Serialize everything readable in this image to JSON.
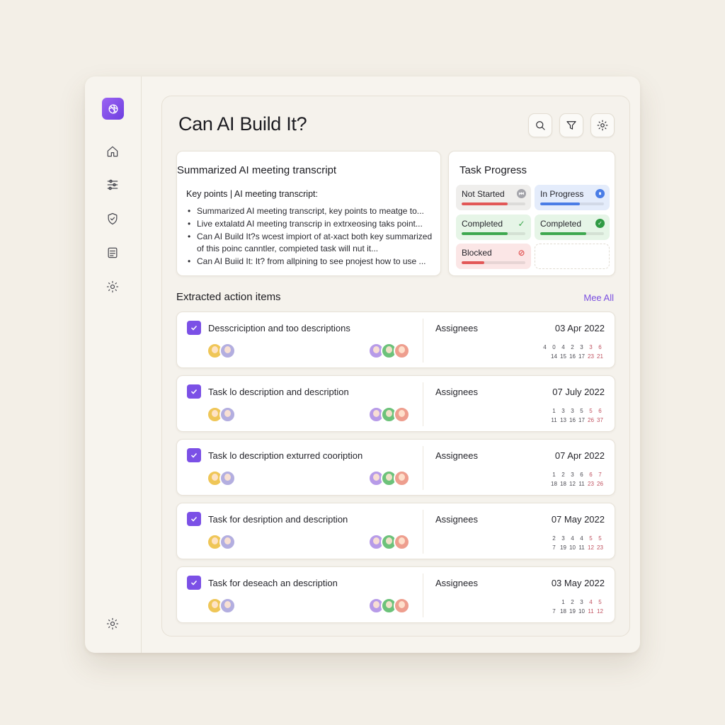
{
  "header": {
    "title": "Can AI Build It?"
  },
  "toolbar": {
    "search_icon": "search-icon",
    "filter_icon": "filter-icon",
    "settings_icon": "gear-icon"
  },
  "sidebar": {
    "logo": "openai-logo",
    "items": [
      {
        "icon": "home-icon"
      },
      {
        "icon": "sliders-icon"
      },
      {
        "icon": "shield-check-icon"
      },
      {
        "icon": "document-icon"
      },
      {
        "icon": "gear-icon"
      }
    ],
    "bottom_icon": "gear-icon"
  },
  "summary": {
    "title": "Summarized AI meeting transcript",
    "subtitle": "Key points | AI meeting transcript:",
    "bullets": [
      "Summarized AI meeting transcript, key points to meatge to...",
      "Live extalatd AI meeting transcrip in extrxeosing taks point...",
      "Can AI Build It?s wcest impiort of at-xact both key summarized of this poinc canntler, compieted task will nut it...",
      "Can AI Buiid It: It? from allpining to see pnojest how to use ..."
    ]
  },
  "progress": {
    "title": "Task Progress",
    "tiles": [
      {
        "label": "Not Started",
        "fill": 0.72,
        "bg": "#efeeec",
        "bar": "#e25757",
        "icon_bg": "#a4a4aa",
        "icon": "⏮"
      },
      {
        "label": "In Progress",
        "fill": 0.62,
        "bg": "#e4ecfb",
        "bar": "#4a7de6",
        "icon_bg": "#4a7de6",
        "icon": "⏸"
      },
      {
        "label": "Completed",
        "fill": 0.72,
        "bg": "#e6f5e7",
        "bar": "#3ea84f",
        "icon_bg": "transparent",
        "icon": "✓"
      },
      {
        "label": "Completed",
        "fill": 0.72,
        "bg": "#e6f5e7",
        "bar": "#3ea84f",
        "icon_bg": "#2f9a44",
        "icon": "✓"
      },
      {
        "label": "Blocked",
        "fill": 0.35,
        "bg": "#fbe6e6",
        "bar": "#e25757",
        "icon_bg": "transparent",
        "icon": "⊘"
      }
    ]
  },
  "actions": {
    "title": "Extracted action items",
    "see_all": "Mee All",
    "assignees_label": "Assignees",
    "rows": [
      {
        "text": "Desscriciption and too descriptions",
        "date": "03 Apr 2022",
        "cal": [
          [
            "4",
            "0",
            "4",
            "2",
            "3",
            "3",
            "6"
          ],
          [
            "14",
            "15",
            "16",
            "17",
            "23",
            "21"
          ]
        ]
      },
      {
        "text": "Task lo description and description",
        "date": "07 July 2022",
        "cal": [
          [
            "1",
            "3",
            "3",
            "5",
            "5",
            "6"
          ],
          [
            "11",
            "13",
            "16",
            "17",
            "26",
            "37"
          ]
        ]
      },
      {
        "text": "Task lo description exturred cooription",
        "date": "07 Apr 2022",
        "cal": [
          [
            "1",
            "2",
            "3",
            "6",
            "6",
            "7"
          ],
          [
            "18",
            "18",
            "12",
            "11",
            "23",
            "26"
          ]
        ]
      },
      {
        "text": "Task for desription and description",
        "date": "07 May 2022",
        "cal": [
          [
            "2",
            "3",
            "4",
            "4",
            "5",
            "5"
          ],
          [
            "7",
            "19",
            "10",
            "11",
            "12",
            "23"
          ]
        ]
      },
      {
        "text": "Task for deseach an description",
        "date": "03 May 2022",
        "cal": [
          [
            "1",
            "2",
            "3",
            "4",
            "5"
          ],
          [
            "7",
            "18",
            "19",
            "10",
            "11",
            "12"
          ]
        ]
      }
    ]
  },
  "colors": {
    "accent": "#7b50e6",
    "background": "#f3efe7"
  }
}
